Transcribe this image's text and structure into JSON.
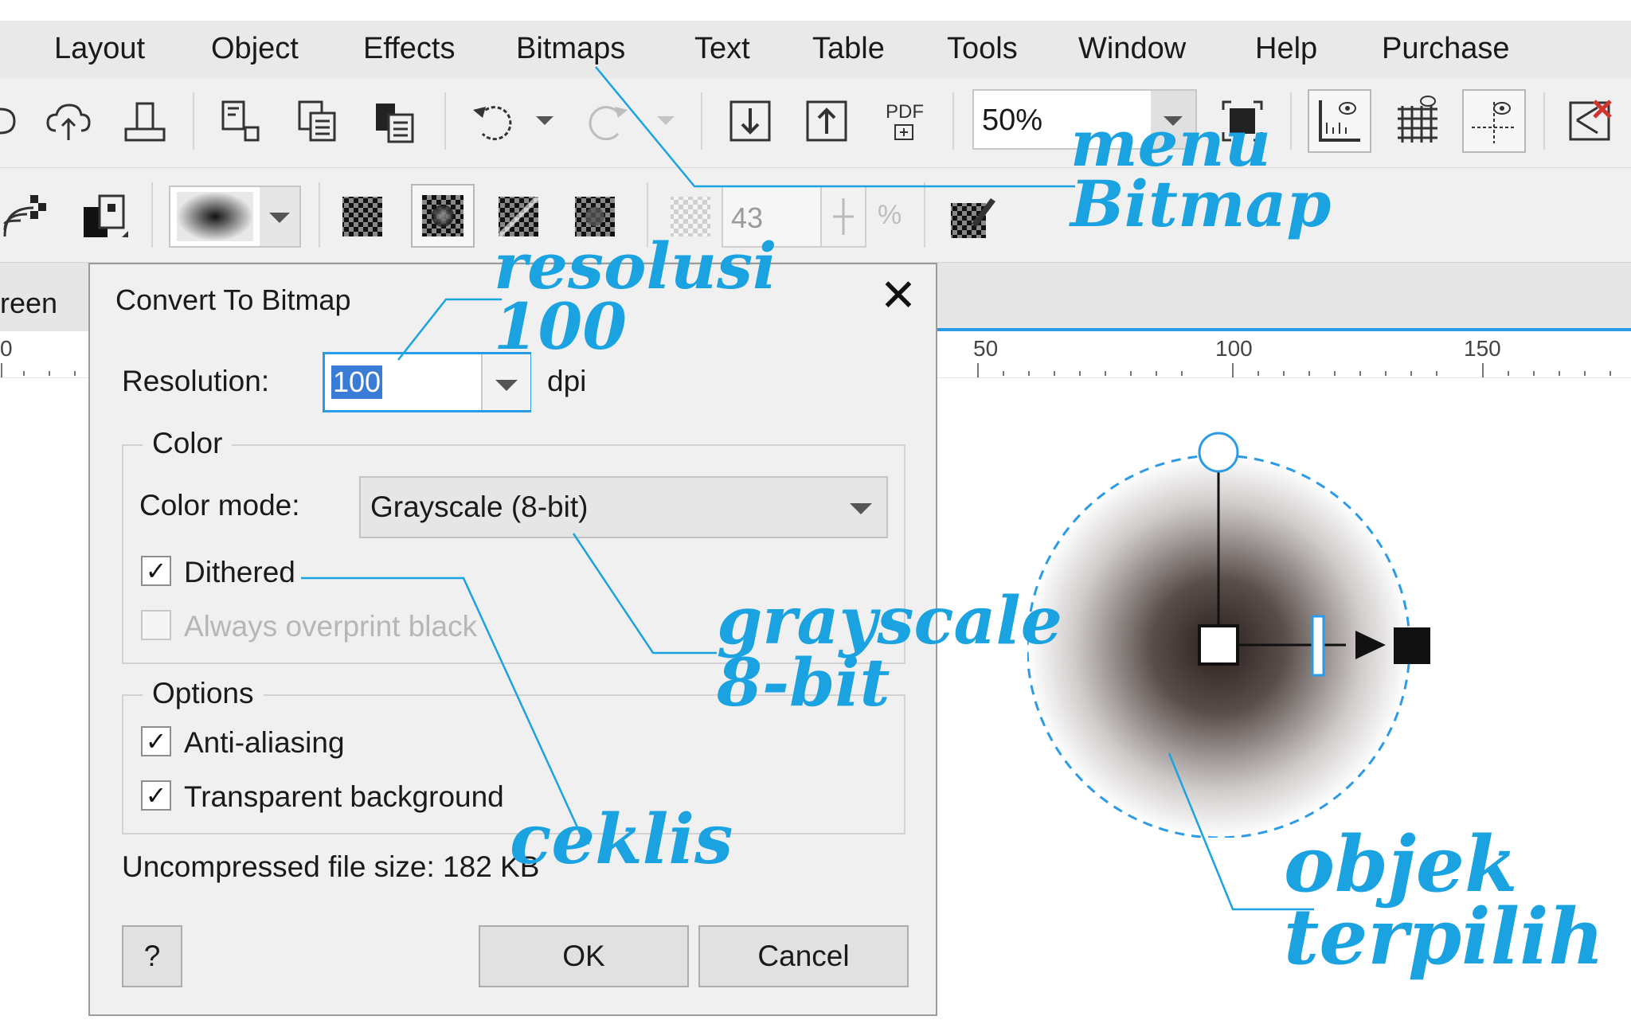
{
  "menu": [
    "Layout",
    "Object",
    "Effects",
    "Bitmaps",
    "Text",
    "Table",
    "Tools",
    "Window",
    "Help",
    "Purchase"
  ],
  "toolbar": {
    "zoom_value": "50%",
    "pdf_label": "PDF",
    "transparency_value": "43",
    "transparency_unit": "%"
  },
  "tabs": {
    "partial_tab_label": "reen"
  },
  "ruler": {
    "labels": [
      "0",
      "50",
      "100",
      "150"
    ]
  },
  "dialog": {
    "title": "Convert To Bitmap",
    "close_glyph": "✕",
    "resolution_label": "Resolution:",
    "resolution_value": "100",
    "resolution_unit": "dpi",
    "color_group_title": "Color",
    "color_mode_label": "Color mode:",
    "color_mode_value": "Grayscale (8-bit)",
    "dithered_label": "Dithered",
    "dithered_checked": true,
    "overprint_label": "Always overprint black",
    "overprint_checked": false,
    "options_group_title": "Options",
    "antialias_label": "Anti-aliasing",
    "antialias_checked": true,
    "transparent_label": "Transparent background",
    "transparent_checked": true,
    "filesize_text": "Uncompressed file size: 182 KB",
    "help_button": "?",
    "ok_button": "OK",
    "cancel_button": "Cancel"
  },
  "annotations": {
    "menu_bitmap_line1": "menu",
    "menu_bitmap_line2": "Bitmap",
    "resolusi_line1": "resolusi",
    "resolusi_line2": "100",
    "grayscale_line1": "grayscale",
    "grayscale_line2": "8-bit",
    "ceklis": "ceklis",
    "objek_line1": "objek",
    "objek_line2": "terpilih"
  },
  "colors": {
    "annotation": "#1aa3e0",
    "selection_blue": "#2b9be8",
    "menu_bg": "#e9e9e9",
    "toolbar_bg": "#f0f0f0",
    "dialog_bg": "#f0f0f0"
  },
  "icons": [
    "cloud-upload-icon",
    "publish-icon",
    "copy-properties-icon",
    "copy-icon",
    "paste-icon",
    "undo-icon",
    "redo-icon",
    "import-icon",
    "export-icon",
    "publish-pdf-icon",
    "full-screen-icon",
    "rulers-icon",
    "grid-icon",
    "guidelines-icon",
    "close-document-icon",
    "transparency-pattern-icon",
    "freeze-icon",
    "brush-icon"
  ]
}
